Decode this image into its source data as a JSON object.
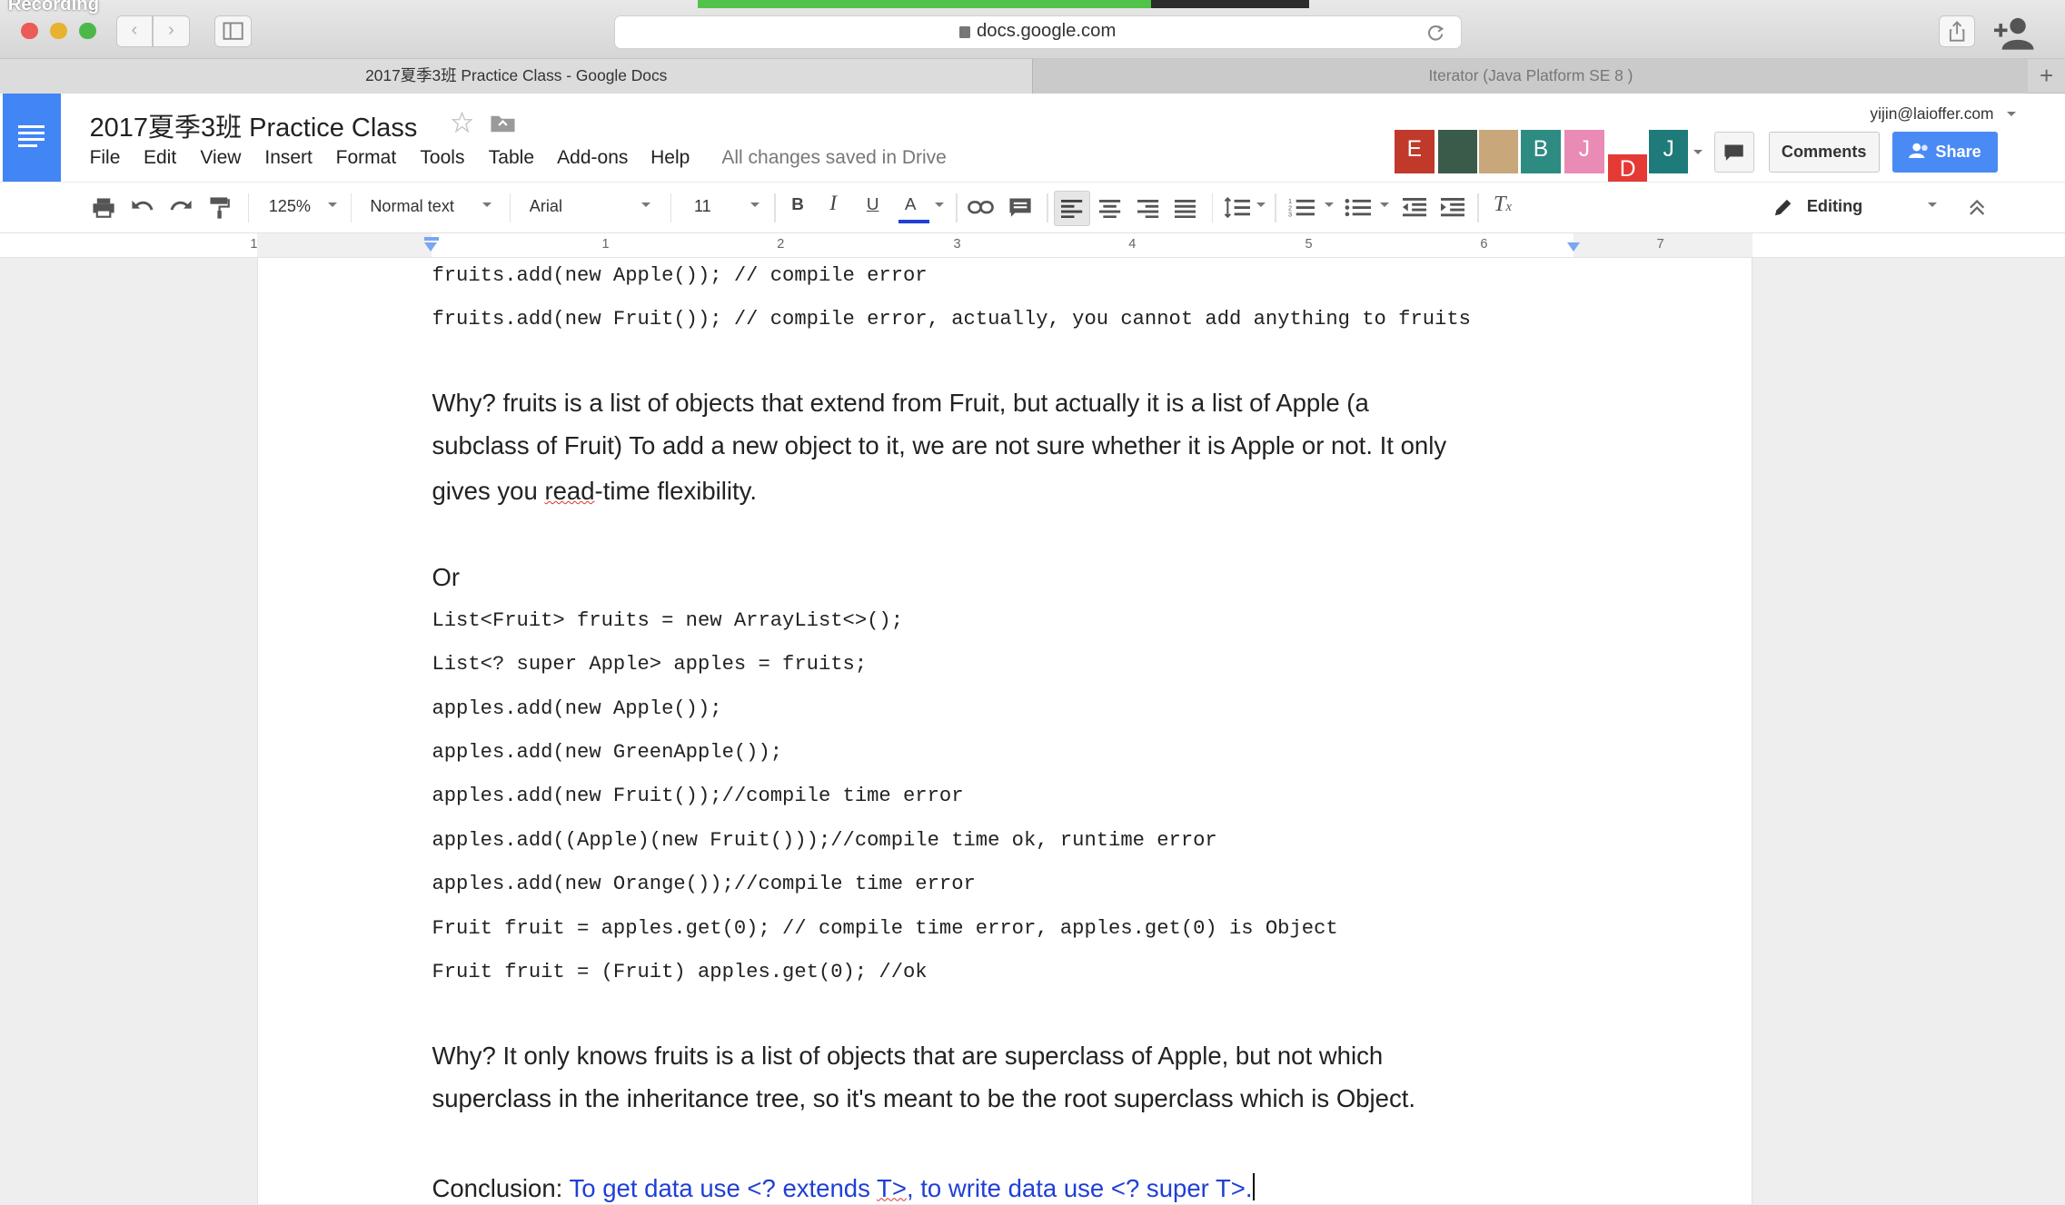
{
  "overlay": {
    "recording": "Recording"
  },
  "browser": {
    "url": "docs.google.com",
    "tabs": [
      {
        "title": "2017夏季3班 Practice Class - Google Docs"
      },
      {
        "title": "Iterator (Java Platform SE 8 )"
      }
    ],
    "new_tab": "+"
  },
  "docs": {
    "title": "2017夏季3班 Practice Class",
    "menu": [
      "File",
      "Edit",
      "View",
      "Insert",
      "Format",
      "Tools",
      "Table",
      "Add-ons",
      "Help"
    ],
    "save_status": "All changes saved in Drive",
    "account": "yijin@laioffer.com",
    "avatars": [
      {
        "letter": "E",
        "color": "#c0392b"
      },
      {
        "letter": "",
        "color": "#3b5b4a"
      },
      {
        "letter": "",
        "color": "#c8a77a"
      },
      {
        "letter": "B",
        "color": "#2e8b82"
      },
      {
        "letter": "J",
        "color": "#e98bb4"
      },
      {
        "letter": "D",
        "color": "#e53935"
      },
      {
        "letter": "J",
        "color": "#1f7a7a"
      }
    ],
    "comments_label": "Comments",
    "share_label": "Share",
    "toolbar": {
      "zoom": "125%",
      "style": "Normal text",
      "font": "Arial",
      "size": "11",
      "mode": "Editing"
    },
    "ruler_numbers": [
      "1",
      "1",
      "2",
      "3",
      "4",
      "5",
      "6",
      "7"
    ]
  },
  "content": {
    "lines": [
      {
        "kind": "code",
        "text": "fruits.add(new Apple()); // compile error"
      },
      {
        "kind": "code",
        "text": "fruits.add(new Fruit()); // compile error, actually, you cannot add anything to fruits"
      },
      {
        "kind": "prose",
        "text": "Why? fruits is a list of objects that extend from Fruit, but actually it is a list of Apple (a"
      },
      {
        "kind": "prose",
        "text": "subclass of Fruit) To add a new object to it, we are not sure whether it is Apple or not. It only"
      },
      {
        "kind": "prose",
        "pre": "gives you ",
        "squiggle": "read",
        "text": "-time flexibility."
      },
      {
        "kind": "prose",
        "text": "Or"
      },
      {
        "kind": "code",
        "text": "List<Fruit> fruits = new ArrayList<>();"
      },
      {
        "kind": "code",
        "text": "List<? super Apple> apples = fruits;"
      },
      {
        "kind": "code",
        "text": "apples.add(new Apple());"
      },
      {
        "kind": "code",
        "text": "apples.add(new GreenApple());"
      },
      {
        "kind": "code",
        "text": "apples.add(new Fruit());//compile time error"
      },
      {
        "kind": "code",
        "text": "apples.add((Apple)(new Fruit()));//compile time ok, runtime error"
      },
      {
        "kind": "code",
        "text": "apples.add(new Orange());//compile time error"
      },
      {
        "kind": "code",
        "text": "Fruit fruit = apples.get(0); // compile time error, apples.get(0) is Object"
      },
      {
        "kind": "code",
        "text": "Fruit fruit = (Fruit) apples.get(0); //ok"
      },
      {
        "kind": "prose",
        "text": "Why? It only knows fruits is a list of objects that are superclass of Apple, but not which"
      },
      {
        "kind": "prose",
        "text": "superclass in the inheritance tree, so it's meant to be the root superclass which is Object."
      }
    ],
    "conclusion": {
      "label": "Conclusion: ",
      "part1": "To get data use <? extends ",
      "part2": "T>",
      "part3": ", to write data use <? super T>."
    }
  }
}
